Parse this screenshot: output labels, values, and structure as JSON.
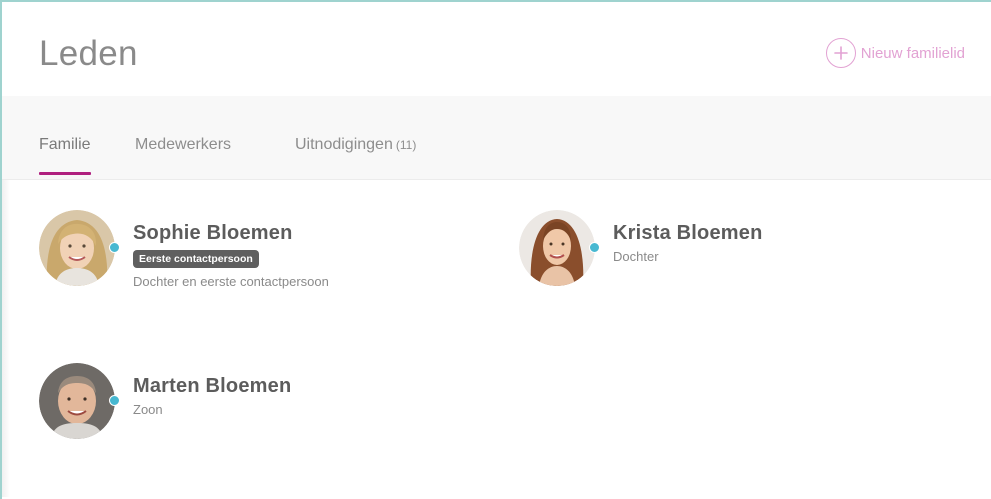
{
  "header": {
    "title": "Leden",
    "new_member_label": "Nieuw familielid",
    "new_member_icon": "plus-circle-icon",
    "accent_color": "#e2a2d3"
  },
  "tabs": [
    {
      "label": "Familie",
      "active": true
    },
    {
      "label": "Medewerkers",
      "active": false
    },
    {
      "label": "Uitnodigingen",
      "count": "(11)",
      "active": false
    }
  ],
  "active_tab_color": "#b0207f",
  "status_color": "#47b8d1",
  "members": [
    {
      "name": "Sophie Bloemen",
      "badge": "Eerste contactpersoon",
      "role": "Dochter en eerste contactpersoon"
    },
    {
      "name": "Krista Bloemen",
      "role": "Dochter"
    },
    {
      "name": "Marten Bloemen",
      "role": "Zoon"
    }
  ]
}
